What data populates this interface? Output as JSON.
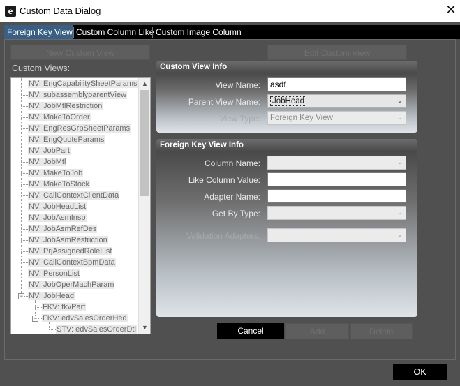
{
  "window": {
    "title": "Custom Data Dialog",
    "app_icon": "e",
    "close_glyph": "✕"
  },
  "tabs": [
    {
      "label": "Foreign Key View",
      "active": true
    },
    {
      "label": "Custom Column Like",
      "active": false
    },
    {
      "label": "Custom Image Column",
      "active": false
    }
  ],
  "buttons": {
    "new_custom_view": "New Custom View",
    "edit_custom_view": "Edit Custom View",
    "cancel": "Cancel",
    "add": "Add",
    "delete": "Delete",
    "ok": "OK"
  },
  "custom_views": {
    "label": "Custom Views:",
    "items": [
      "NV: EngCapabilitySheetParams",
      "NV: subassemblyparentView",
      "NV: JobMtlRestriction",
      "NV: MakeToOrder",
      "NV: EngResGrpSheetParams",
      "NV: EngQuoteParams",
      "NV: JobPart",
      "NV: JobMtl",
      "NV: MakeToJob",
      "NV: MakeToStock",
      "NV: CallContextClientData",
      "NV: JobHeadList",
      "NV: JobAsmInsp",
      "NV: JobAsmRefDes",
      "NV: JobAsmRestriction",
      "NV: PrjAssignedRoleList",
      "NV: CallContextBpmData",
      "NV: PersonList",
      "NV: JobOperMachParam",
      "NV: JobHead",
      "FKV: fkvPart",
      "FKV: edvSalesOrderHed",
      "STV: edvSalesOrderDtl"
    ]
  },
  "custom_view_info": {
    "heading": "Custom View Info",
    "view_name_label": "View Name:",
    "view_name_value": "asdf",
    "parent_view_label": "Parent View Name:",
    "parent_view_value": "JobHead",
    "view_type_label": "View Type:",
    "view_type_value": "Foreign Key View"
  },
  "fk_view_info": {
    "heading": "Foreign Key View Info",
    "column_name_label": "Column Name:",
    "column_name_value": "",
    "like_column_label": "Like Column Value:",
    "like_column_value": "",
    "adapter_name_label": "Adapter Name:",
    "adapter_name_value": "",
    "get_by_type_label": "Get By Type:",
    "get_by_type_value": "",
    "validation_adapters_label": "Validation Adapters:",
    "validation_adapters_value": ""
  },
  "icons": {
    "dropdown": "chevron-down-icon",
    "scroll_up": "scroll-up-icon",
    "scroll_down": "scroll-down-icon",
    "expander": "tree-expander-icon"
  },
  "colors": {
    "active_tab": "#3a5f85",
    "dialog_bg": "#505050",
    "primary_button": "#000000"
  }
}
